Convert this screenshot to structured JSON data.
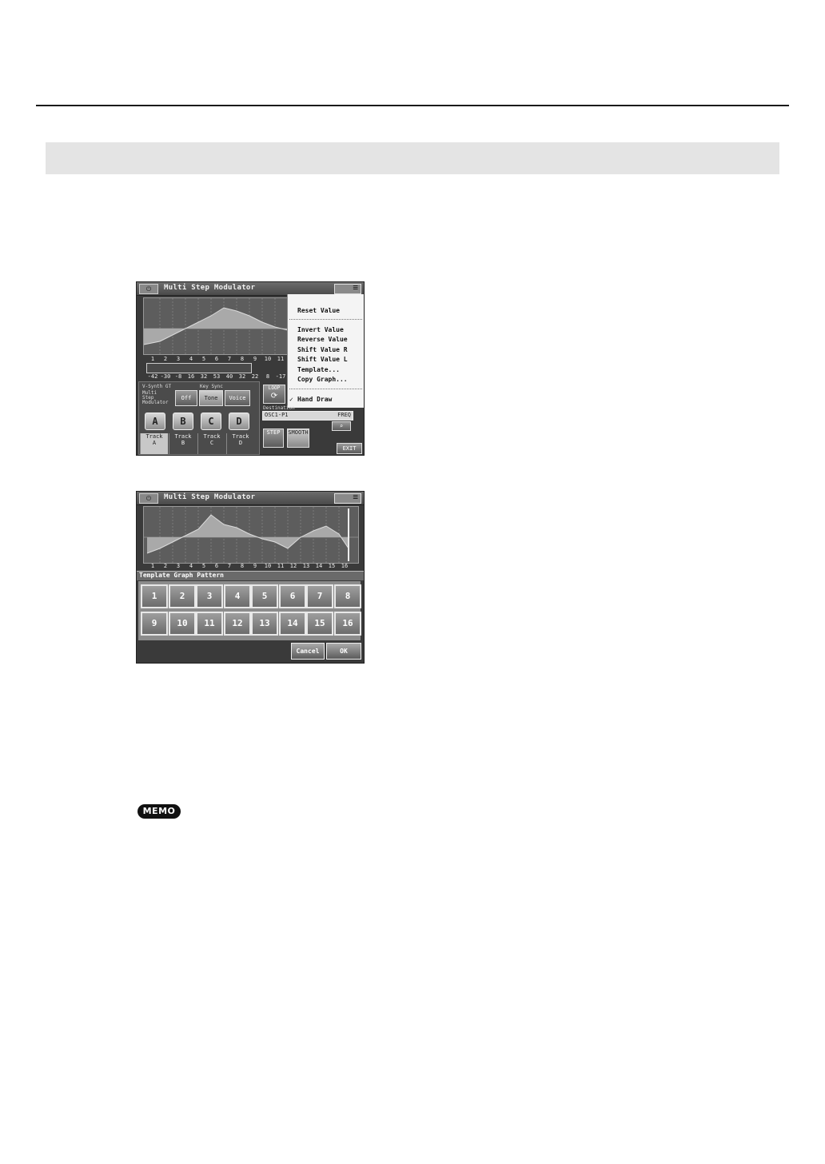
{
  "screen1": {
    "title": "Multi Step Modulator",
    "step_numbers": [
      "1",
      "2",
      "3",
      "4",
      "5",
      "6",
      "7",
      "8",
      "9",
      "10",
      "11"
    ],
    "step_values": [
      "-42",
      "-30",
      "-8",
      "16",
      "32",
      "53",
      "40",
      "32",
      "22",
      "8",
      "-17"
    ],
    "menu_items": [
      "Reset Value",
      "Invert Value",
      "Reverse Value",
      "Shift Value R",
      "Shift Value L",
      "Template...",
      "Copy Graph...",
      "Hand Draw"
    ],
    "menu_check": "✓",
    "sidebar_text": [
      "V-Synth GT",
      "Multi",
      "Step",
      "Modulator"
    ],
    "key_sync_label": "Key Sync",
    "key_sync_options": [
      "Off",
      "Tone",
      "Voice"
    ],
    "loop_label": "LOOP",
    "tracks": [
      "A",
      "B",
      "C",
      "D"
    ],
    "track_tabs": [
      {
        "line1": "Track",
        "line2": "A"
      },
      {
        "line1": "Track",
        "line2": "B"
      },
      {
        "line1": "Track",
        "line2": "C"
      },
      {
        "line1": "Track",
        "line2": "D"
      }
    ],
    "destination_label": "Destination",
    "destination_value": "OSC1-P1",
    "destination_param": "FREQ",
    "step_label": "STEP",
    "smooth_label": "SMOOTH",
    "exit_label": "EXIT"
  },
  "screen2": {
    "title": "Multi Step Modulator",
    "step_numbers": [
      "1",
      "2",
      "3",
      "4",
      "5",
      "6",
      "7",
      "8",
      "9",
      "10",
      "11",
      "12",
      "13",
      "14",
      "15",
      "16"
    ],
    "template_title": "Template Graph Pattern",
    "patterns": [
      "1",
      "2",
      "3",
      "4",
      "5",
      "6",
      "7",
      "8",
      "9",
      "10",
      "11",
      "12",
      "13",
      "14",
      "15",
      "16"
    ],
    "cancel_label": "Cancel",
    "ok_label": "OK"
  },
  "memo_label": "MEMO"
}
